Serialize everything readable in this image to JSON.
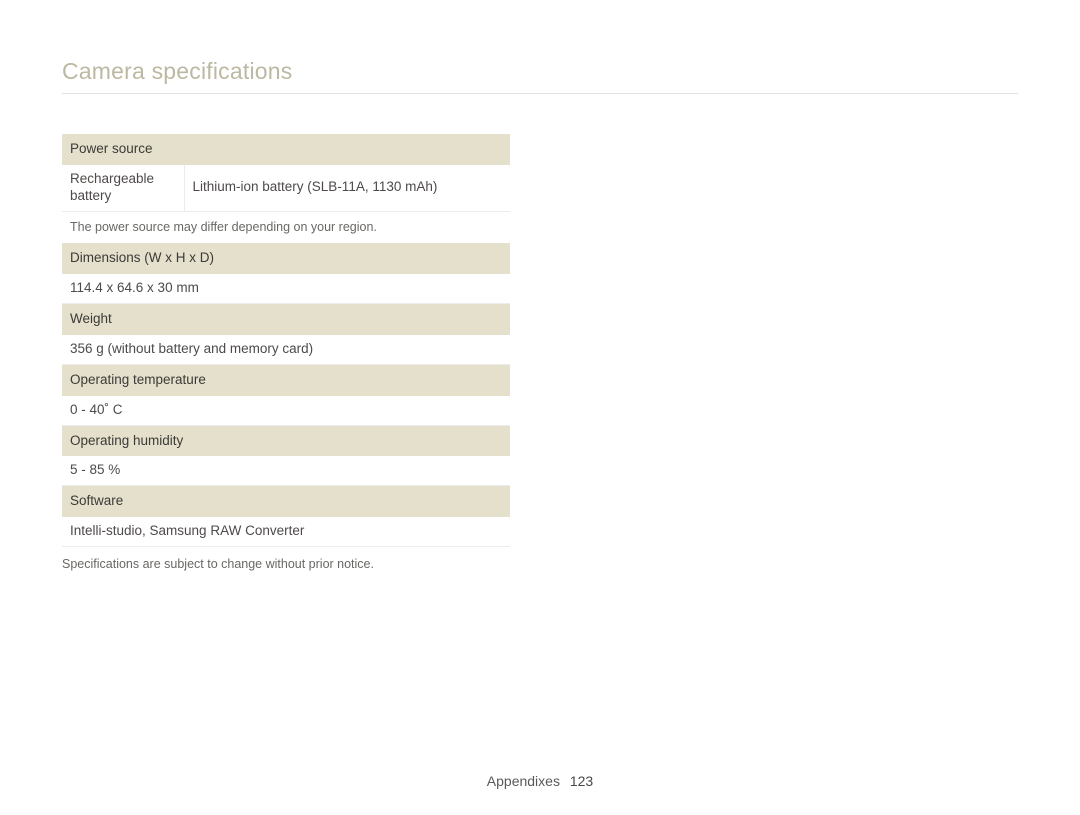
{
  "title": "Camera specifications",
  "sections": {
    "power_source": {
      "header": "Power source",
      "key": "Rechargeable battery",
      "value": "Lithium-ion battery (SLB-11A, 1130 mAh)",
      "note": "The power source may differ depending on your region."
    },
    "dimensions": {
      "header": "Dimensions (W x H x D)",
      "value": "114.4 x 64.6 x 30 mm"
    },
    "weight": {
      "header": "Weight",
      "value": "356 g (without battery and memory card)"
    },
    "operating_temperature": {
      "header": "Operating temperature",
      "value": "0 - 40˚ C"
    },
    "operating_humidity": {
      "header": "Operating humidity",
      "value": "5 - 85 %"
    },
    "software": {
      "header": "Software",
      "value": "Intelli-studio, Samsung RAW Converter"
    }
  },
  "footnote": "Specifications are subject to change without prior notice.",
  "footer": {
    "section": "Appendixes",
    "page": "123"
  }
}
